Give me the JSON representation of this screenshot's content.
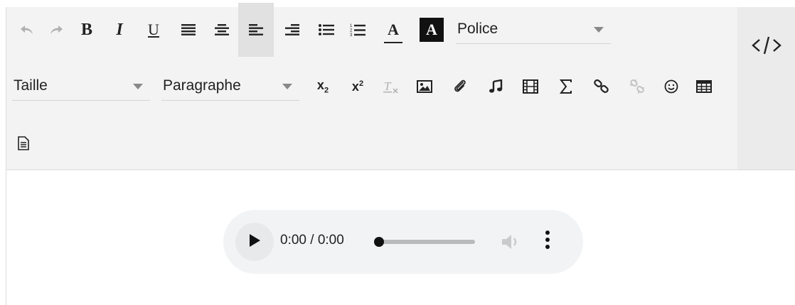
{
  "toolbar": {
    "font_select": {
      "label": "Police"
    },
    "size_select": {
      "label": "Taille"
    },
    "block_select": {
      "label": "Paragraphe"
    },
    "bold_glyph": "B",
    "italic_glyph": "I",
    "underline_glyph": "U",
    "font_color_glyph": "A",
    "bg_color_glyph": "A",
    "subscript": {
      "base": "x",
      "index": "2"
    },
    "superscript": {
      "base": "x",
      "index": "2"
    },
    "active_alignment": "align-left"
  },
  "audio_player": {
    "time_display": "0:00 / 0:00",
    "progress": 0
  },
  "colors": {
    "toolbar_bg": "#f3f3f3",
    "code_panel_bg": "#ebebeb",
    "active_button_bg": "#e1e1e1",
    "player_bg": "#f1f3f4",
    "icon_color": "#222222",
    "disabled_icon_color": "#b0b0b0"
  }
}
